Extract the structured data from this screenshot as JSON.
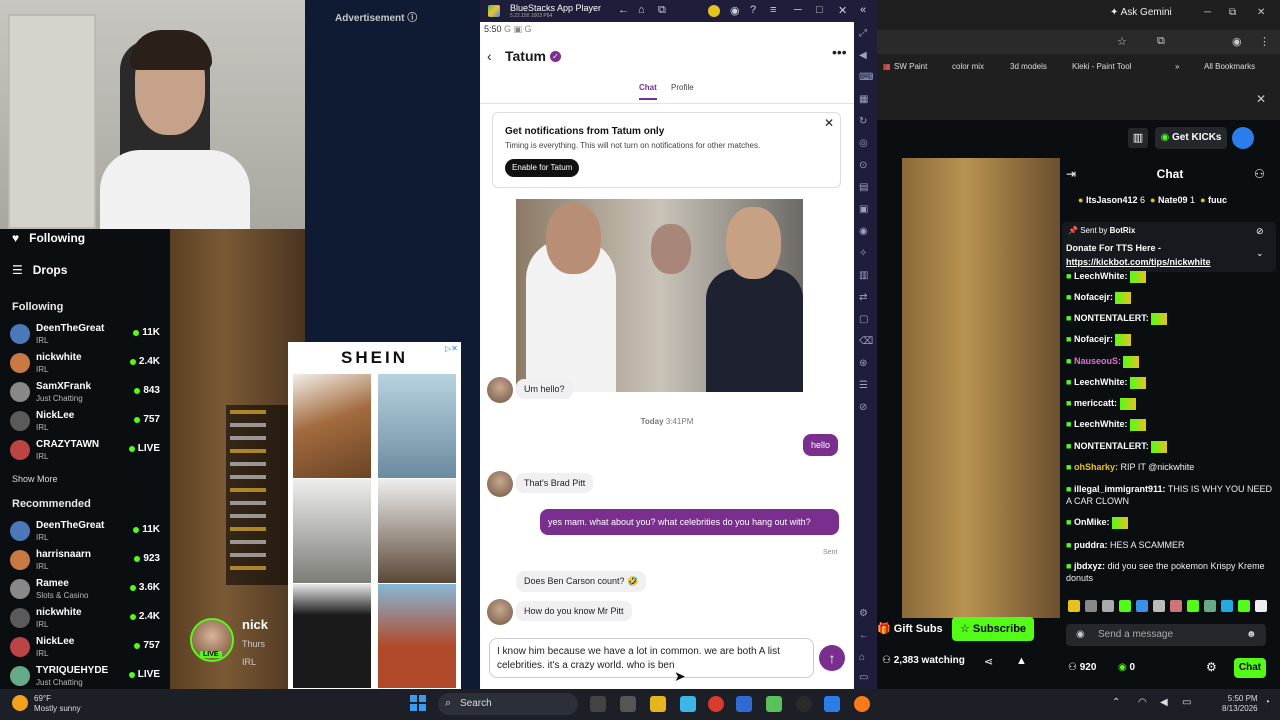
{
  "webcam": {},
  "left_nav": {
    "following_label": "Following",
    "drops_label": "Drops",
    "section_following": "Following",
    "following_channels": [
      {
        "name": "DeenTheGreat",
        "category": "IRL",
        "viewers": "11K"
      },
      {
        "name": "nickwhite",
        "category": "IRL",
        "viewers": "2.4K"
      },
      {
        "name": "SamXFrank",
        "category": "Just Chatting",
        "viewers": "843"
      },
      {
        "name": "NickLee",
        "category": "IRL",
        "viewers": "757"
      },
      {
        "name": "CRAZYTAWN",
        "category": "IRL",
        "viewers": "LIVE"
      }
    ],
    "show_more": "Show More",
    "section_recommended": "Recommended",
    "recommended_channels": [
      {
        "name": "DeenTheGreat",
        "category": "IRL",
        "viewers": "11K"
      },
      {
        "name": "harrisnaarn",
        "category": "IRL",
        "viewers": "923"
      },
      {
        "name": "Ramee",
        "category": "Slots & Casino",
        "viewers": "3.6K"
      },
      {
        "name": "nickwhite",
        "category": "IRL",
        "viewers": "2.4K"
      },
      {
        "name": "NickLee",
        "category": "IRL",
        "viewers": "757"
      },
      {
        "name": "TYRIQUEHYDE",
        "category": "Just Chatting",
        "viewers": "LIVE"
      }
    ]
  },
  "ad": {
    "label": "Advertisement ⓘ",
    "brand": "SHEIN"
  },
  "stream_overlay": {
    "name_partial": "nick",
    "sub_partial": "Thurs",
    "live_badge": "LIVE",
    "cat": "IRL"
  },
  "bluestacks": {
    "title": "BlueStacks App Player",
    "version": "5.22.150.1003 P64",
    "status_time": "5:50",
    "status_icons": "G ▣ G"
  },
  "dating_app": {
    "match_name": "Tatum",
    "tabs": [
      {
        "label": "Chat",
        "active": true
      },
      {
        "label": "Profile",
        "active": false
      }
    ],
    "notif_heading": "Get notifications from Tatum only",
    "notif_sub": "Timing is everything. This will not turn on notifications for other matches.",
    "notif_button": "Enable for Tatum",
    "msg1": "Um hello?",
    "date_day": "Today",
    "date_time": "3:41PM",
    "msg_me1": "hello",
    "msg2": "That's Brad Pitt",
    "msg_me2": "yes mam. what about you? what celebrities do you hang out with?",
    "sent_label": "Sent",
    "msg3": "Does Ben Carson count? 🤣",
    "msg4": "How do you know Mr Pitt",
    "input_text": "I know him because we have a lot in common. we are both A list celebrities. it's a crazy world. who is ben"
  },
  "chrome": {
    "ask_gemini": "Ask Gemini",
    "bookmarks": [
      "SW Paint",
      "color mix",
      "3d models",
      "Kleki - Paint Tool"
    ],
    "all_bookmarks": "All Bookmarks"
  },
  "kick": {
    "get_kicks": "Get KICKs",
    "chat_title": "Chat",
    "top_users": [
      "ItsJason412",
      "6",
      "Nate09",
      "1",
      "fuuc"
    ],
    "pinned_sent_by": "Sent by",
    "pinned_bot": "BotRix",
    "pinned_line1": "Donate For TTS Here -",
    "pinned_link": "https://kickbot.com/tips/nickwhite",
    "messages": [
      {
        "user": "LeechWhite:",
        "text": ""
      },
      {
        "user": "Nofacejr:",
        "text": ""
      },
      {
        "user": "NONTENTALERT:",
        "text": ""
      },
      {
        "user": "Nofacejr:",
        "text": ""
      },
      {
        "user": "NauseouS:",
        "text": ""
      },
      {
        "user": "LeechWhite:",
        "text": ""
      },
      {
        "user": "mericcatt:",
        "text": ""
      },
      {
        "user": "LeechWhite:",
        "text": ""
      },
      {
        "user": "NONTENTALERT:",
        "text": ""
      },
      {
        "user": "ohSharky:",
        "text": "RIP IT @nickwhite"
      },
      {
        "user": "illegal_immigrant911:",
        "text": "THIS IS WHY YOU NEED A CAR CLOWN"
      },
      {
        "user": "OnMike:",
        "text": ""
      },
      {
        "user": "puddra:",
        "text": "HES A SCAMMER"
      },
      {
        "user": "jbdxyz:",
        "text": "did you see the pokemon Krispy Kreme donuts"
      }
    ],
    "gift_subs": "Gift Subs",
    "subscribe": "Subscribe",
    "send_placeholder": "Send a message",
    "watching": "2,383 watching",
    "points": "920",
    "kicks": "0",
    "chat_button": "Chat"
  },
  "taskbar": {
    "temp": "69°F",
    "weather": "Mostly sunny",
    "search": "Search",
    "time": "5:50 PM",
    "date": "8/13/2026"
  },
  "colors": {
    "kick_green": "#53fc18",
    "app_purple": "#7a2f8f"
  }
}
